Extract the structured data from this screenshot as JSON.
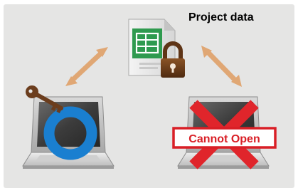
{
  "diagram": {
    "title": "Project data",
    "denied_label": "Cannot Open",
    "colors": {
      "background": "#e5e5e4",
      "arrow": "#e0a774",
      "access_ring": "#1a7fd0",
      "deny_cross": "#e0252b",
      "key": "#6b3d1d",
      "lock": "#6b3d1d",
      "file_accent": "#2f9a4f"
    },
    "icons": {
      "file": "spreadsheet-file-icon",
      "lock": "padlock-icon",
      "key": "key-icon",
      "left_device": "laptop-icon",
      "right_device": "laptop-icon",
      "allow_mark": "circle-ok-icon",
      "deny_mark": "cross-icon"
    }
  }
}
